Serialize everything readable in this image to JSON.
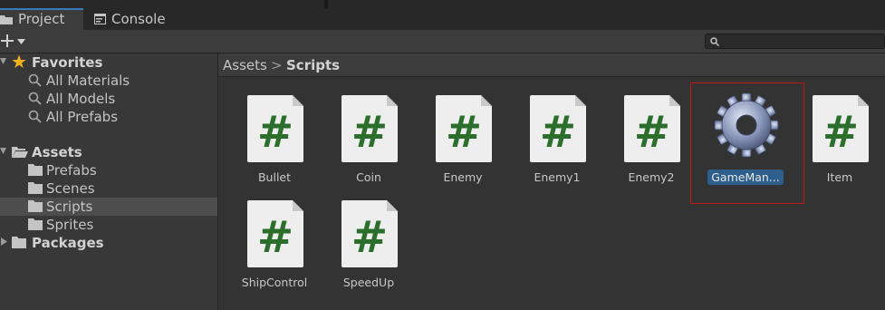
{
  "tabs": [
    {
      "label": "Project",
      "icon": "folder-icon",
      "active": true
    },
    {
      "label": "Console",
      "icon": "console-icon",
      "active": false
    }
  ],
  "toolbar": {
    "add_icon": "plus-icon",
    "dropdown_icon": "chevron-down-icon",
    "search_icon": "search-icon",
    "search_value": ""
  },
  "sidebar": {
    "favorites": {
      "label": "Favorites",
      "icon": "star-icon",
      "items": [
        "All Materials",
        "All Models",
        "All Prefabs"
      ]
    },
    "assets": {
      "label": "Assets",
      "icon": "folder-open-icon",
      "items": [
        "Prefabs",
        "Scenes",
        "Scripts",
        "Sprites"
      ],
      "selected": "Scripts"
    },
    "packages": {
      "label": "Packages",
      "icon": "folder-icon"
    }
  },
  "breadcrumb": {
    "root": "Assets",
    "separator": ">",
    "current": "Scripts"
  },
  "assets": [
    {
      "name": "Bullet",
      "type": "script"
    },
    {
      "name": "Coin",
      "type": "script"
    },
    {
      "name": "Enemy",
      "type": "script"
    },
    {
      "name": "Enemy1",
      "type": "script"
    },
    {
      "name": "Enemy2",
      "type": "script"
    },
    {
      "name": "GameMan...",
      "type": "gear",
      "selected": true
    },
    {
      "name": "Item",
      "type": "script"
    },
    {
      "name": "ShipControl",
      "type": "script"
    },
    {
      "name": "SpeedUp",
      "type": "script"
    }
  ],
  "colors": {
    "hash_green": "#2c6e2c",
    "selection_blue": "#2d5e8c",
    "highlight_red": "#c01818",
    "star_yellow": "#f2b21b"
  }
}
